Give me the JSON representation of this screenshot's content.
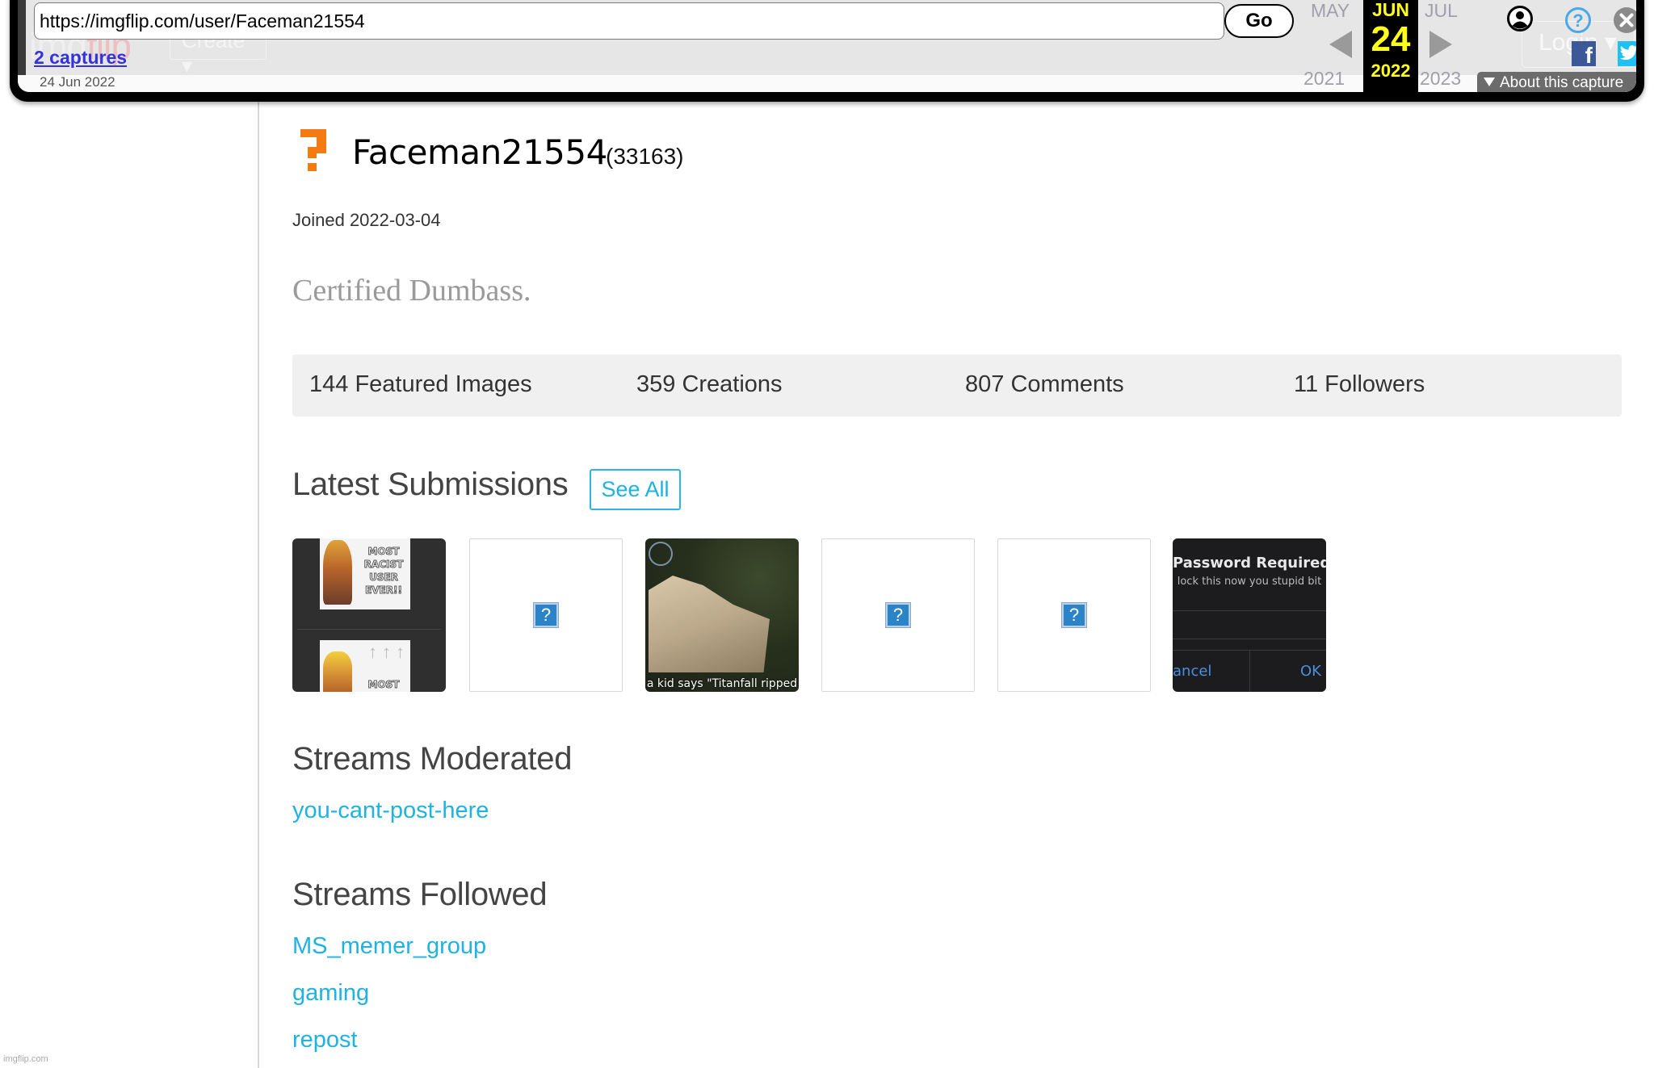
{
  "wayback": {
    "url": "https://imgflip.com/user/Faceman21554",
    "go_label": "Go",
    "captures_label": "2 captures",
    "capture_range": "24 Jun 2022",
    "calendar": {
      "prev_month": "MAY",
      "current_month": "JUN",
      "next_month": "JUL",
      "current_day": "24",
      "prev_year": "2021",
      "current_year": "2022",
      "next_year": "2023"
    },
    "about_label": "About this capture",
    "icons": [
      "user-icon",
      "help-icon",
      "close-icon",
      "facebook-icon",
      "twitter-icon"
    ]
  },
  "ghost_header": {
    "logo_main": "img",
    "logo_accent": "flip",
    "create_label": "Create ▾",
    "login_label": "Login ▾"
  },
  "profile": {
    "username": "Faceman21554",
    "points": "(33163)",
    "joined": "Joined 2022-03-04",
    "bio": "Certified Dumbass.",
    "avatar_color": "#f47a12"
  },
  "stats": [
    {
      "label": "144 Featured Images"
    },
    {
      "label": "359 Creations"
    },
    {
      "label": "807 Comments"
    },
    {
      "label": "11 Followers"
    }
  ],
  "latest_submissions": {
    "title": "Latest Submissions",
    "see_all_label": "See All",
    "items": [
      {
        "type": "image",
        "caption": "MOST RACIST USER EVER!!",
        "caption2": "MOST"
      },
      {
        "type": "broken-image"
      },
      {
        "type": "image",
        "caption": "a kid says \"Titanfall ripped"
      },
      {
        "type": "broken-image"
      },
      {
        "type": "broken-image"
      },
      {
        "type": "image",
        "title": "Password Required",
        "subtitle": "lock this now you stupid bit",
        "cancel": "ancel",
        "ok": "OK"
      }
    ]
  },
  "streams_moderated": {
    "title": "Streams Moderated",
    "items": [
      "you-cant-post-here"
    ]
  },
  "streams_followed": {
    "title": "Streams Followed",
    "items": [
      "MS_memer_group",
      "gaming",
      "repost"
    ]
  },
  "watermark": "imgflip.com",
  "colors": {
    "link": "#1fb2e3",
    "accent_orange": "#f47a12",
    "wayback_highlight": "#ffff1a"
  }
}
